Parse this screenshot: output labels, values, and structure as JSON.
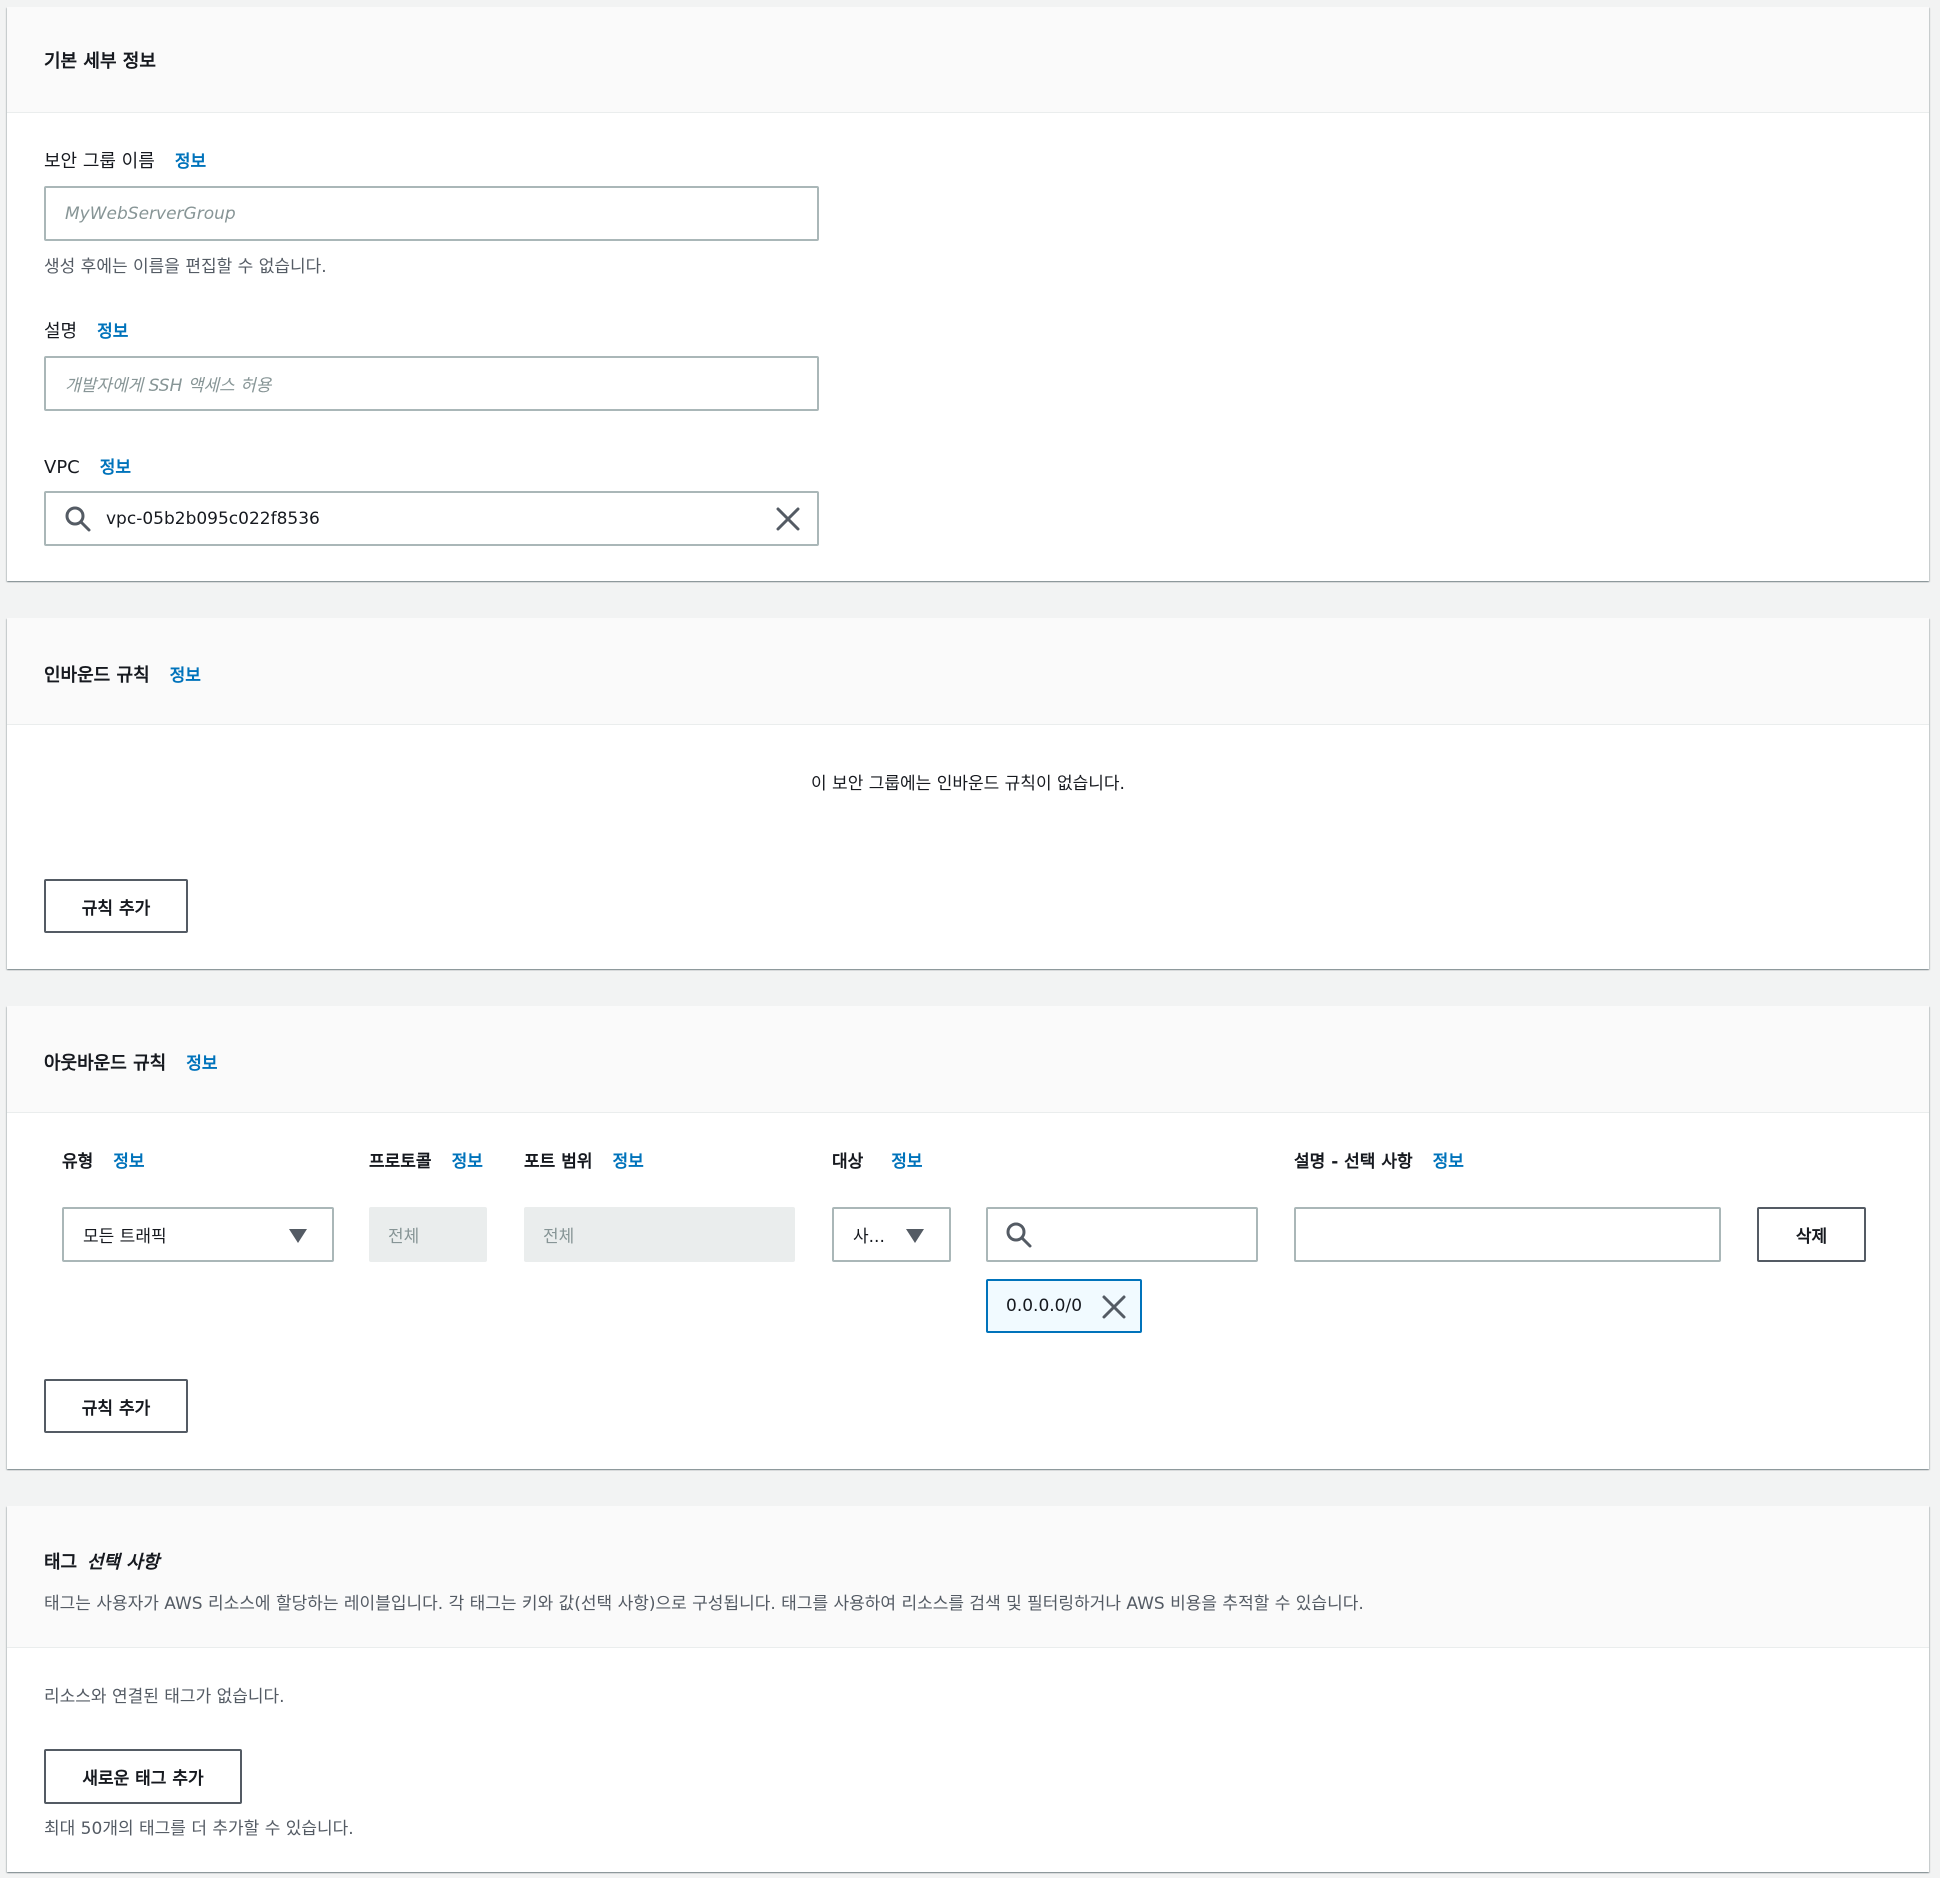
{
  "basic": {
    "title": "기본 세부 정보",
    "name_label": "보안 그룹 이름",
    "name_info": "정보",
    "name_placeholder": "MyWebServerGroup",
    "name_hint": "생성 후에는 이름을 편집할 수 없습니다.",
    "desc_label": "설명",
    "desc_info": "정보",
    "desc_placeholder": "개발자에게 SSH 액세스 허용",
    "vpc_label": "VPC",
    "vpc_info": "정보",
    "vpc_value": "vpc-05b2b095c022f8536"
  },
  "inbound": {
    "title": "인바운드 규칙",
    "info": "정보",
    "empty": "이 보안 그룹에는 인바운드 규칙이 없습니다.",
    "add_rule": "규칙 추가"
  },
  "outbound": {
    "title": "아웃바운드 규칙",
    "info": "정보",
    "columns": {
      "type": "유형",
      "protocol": "프로토콜",
      "port_range": "포트 범위",
      "destination": "대상",
      "description": "설명 - 선택 사항",
      "info": "정보"
    },
    "row": {
      "type_value": "모든 트래픽",
      "protocol_value": "전체",
      "port_value": "전체",
      "dest_type": "사...",
      "dest_search": "",
      "description": "",
      "token": "0.0.0.0/0",
      "delete": "삭제"
    },
    "add_rule": "규칙 추가"
  },
  "tags": {
    "title_main": "태그",
    "title_optional": "선택 사항",
    "description": "태그는 사용자가 AWS 리소스에 할당하는 레이블입니다. 각 태그는 키와 값(선택 사항)으로 구성됩니다. 태그를 사용하여 리소스를 검색 및 필터링하거나 AWS 비용을 추적할 수 있습니다.",
    "empty": "리소스와 연결된 태그가 없습니다.",
    "add_tag": "새로운 태그 추가",
    "limit_hint": "최대 50개의 태그를 더 추가할 수 있습니다."
  }
}
